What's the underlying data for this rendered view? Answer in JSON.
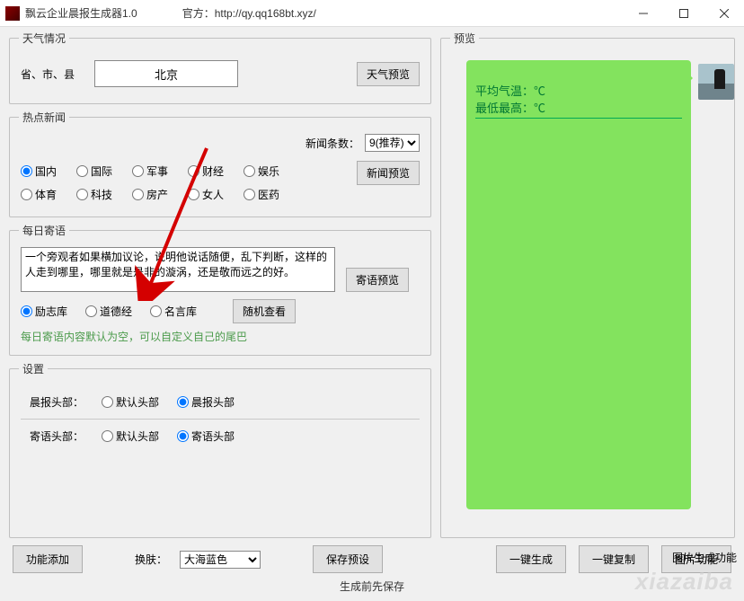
{
  "title": "飘云企业晨报生成器1.0",
  "official_label": "官方：http://qy.qq168bt.xyz/",
  "weather": {
    "legend": "天气情况",
    "location_label": "省、市、县",
    "city_value": "北京",
    "preview_btn": "天气预览"
  },
  "news": {
    "legend": "热点新闻",
    "count_label": "新闻条数：",
    "count_value": "9(推荐)",
    "preview_btn": "新闻预览",
    "categories": [
      "国内",
      "国际",
      "军事",
      "财经",
      "娱乐",
      "体育",
      "科技",
      "房产",
      "女人",
      "医药"
    ]
  },
  "quote": {
    "legend": "每日寄语",
    "text": "一个旁观者如果横加议论，说明他说话随便，乱下判断，这样的人走到哪里，哪里就是是非的漩涡，还是敬而远之的好。",
    "preview_btn": "寄语预览",
    "random_btn": "随机查看",
    "sources": [
      "励志库",
      "道德经",
      "名言库"
    ],
    "hint": "每日寄语内容默认为空，可以自定义自己的尾巴"
  },
  "settings": {
    "legend": "设置",
    "morning_header_label": "晨报头部：",
    "morning_opts": [
      "默认头部",
      "晨报头部"
    ],
    "quote_header_label": "寄语头部：",
    "quote_opts": [
      "默认头部",
      "寄语头部"
    ]
  },
  "preview": {
    "legend": "预览",
    "line1": "平均气温：℃",
    "line2": "最低最高：℃"
  },
  "bottom": {
    "add_fn": "功能添加",
    "skin_label": "换肤：",
    "skin_value": "大海蓝色",
    "save_preset": "保存预设",
    "one_gen": "一键生成",
    "one_copy": "一键复制",
    "img_fn": "图片功能",
    "img_gen_fn": "图片生成功能",
    "note": "生成前先保存"
  },
  "watermark": "xiazaiba"
}
